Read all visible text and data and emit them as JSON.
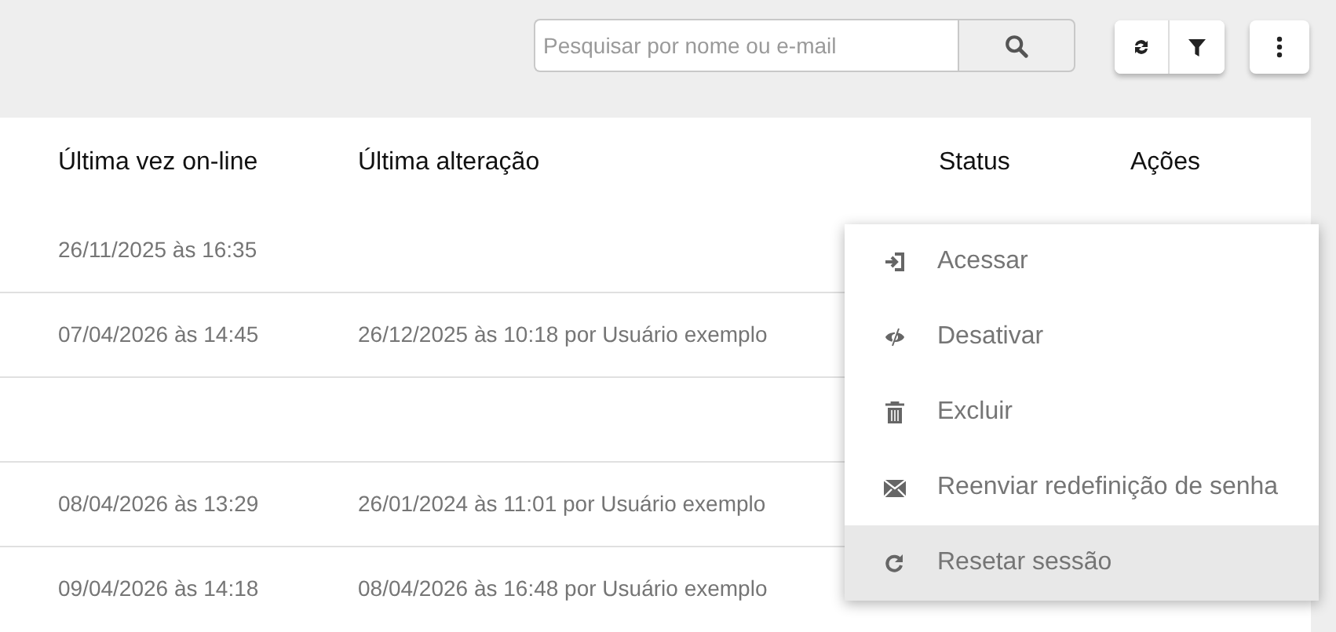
{
  "toolbar": {
    "search": {
      "placeholder": "Pesquisar por nome ou e-mail"
    }
  },
  "table": {
    "columns": [
      "Última vez on-line",
      "Última alteração",
      "Status",
      "Ações"
    ],
    "rows": [
      {
        "last_online": "26/11/2025 às 16:35"
      },
      {
        "last_online": "07/04/2026 às 14:45",
        "last_change": "26/12/2025 às 10:18 por Usuário exemplo"
      },
      {},
      {
        "last_online": "08/04/2026 às 13:29",
        "last_change": "26/01/2024 às 11:01 por Usuário exemplo"
      },
      {
        "last_online": "09/04/2026 às 14:18",
        "last_change": "08/04/2026 às 16:48 por Usuário exemplo"
      }
    ]
  },
  "actions_menu": {
    "items": [
      {
        "label": "Acessar",
        "highlighted": false
      },
      {
        "label": "Desativar",
        "highlighted": false
      },
      {
        "label": "Excluir",
        "highlighted": false
      },
      {
        "label": "Reenviar redefinição de senha",
        "highlighted": false
      },
      {
        "label": "Resetar sessão",
        "highlighted": true
      }
    ]
  }
}
